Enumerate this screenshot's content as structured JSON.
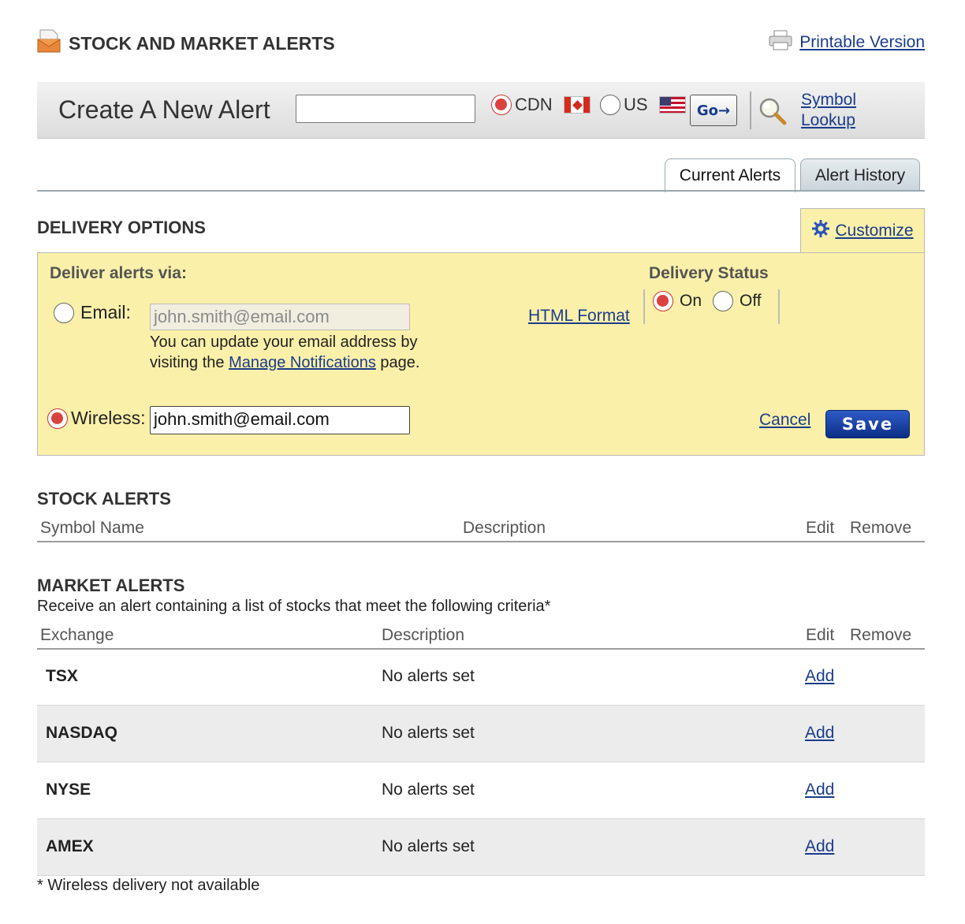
{
  "header": {
    "title": "STOCK AND MARKET ALERTS",
    "printable_label": "Printable Version"
  },
  "create_alert": {
    "title": "Create A New Alert",
    "symbol_value": "",
    "market_options": [
      {
        "label": "CDN",
        "selected": true,
        "flag": "canada-flag-icon"
      },
      {
        "label": "US",
        "selected": false,
        "flag": "us-flag-icon"
      }
    ],
    "go_label": "Go→",
    "symbol_lookup_line1": "Symbol",
    "symbol_lookup_line2": "Lookup"
  },
  "tabs": [
    {
      "label": "Current Alerts",
      "active": true
    },
    {
      "label": "Alert History",
      "active": false
    }
  ],
  "delivery": {
    "section_title": "DELIVERY OPTIONS",
    "customize_label": "Customize",
    "deliver_via_label": "Deliver alerts via:",
    "email_label": "Email:",
    "email_value": "john.smith@email.com",
    "email_selected": false,
    "note_before": "You can update your email address by visiting the ",
    "note_link": "Manage Notifications",
    "note_after": " page.",
    "wireless_label": "Wireless:",
    "wireless_value": "john.smith@email.com",
    "wireless_selected": true,
    "html_format_label": "HTML Format",
    "status_label": "Delivery Status",
    "status_on": "On",
    "status_off": "Off",
    "status_selected": "On",
    "cancel_label": "Cancel",
    "save_label": "Save"
  },
  "stock_alerts": {
    "title": "STOCK ALERTS",
    "columns": [
      "Symbol Name",
      "Description",
      "Edit",
      "Remove"
    ]
  },
  "market_alerts": {
    "title": "MARKET ALERTS",
    "subtitle": "Receive an alert containing a list of stocks that meet the following criteria*",
    "columns": [
      "Exchange",
      "Description",
      "Edit",
      "Remove"
    ],
    "rows": [
      {
        "exchange": "TSX",
        "description": "No alerts set",
        "action": "Add"
      },
      {
        "exchange": "NASDAQ",
        "description": "No alerts set",
        "action": "Add"
      },
      {
        "exchange": "NYSE",
        "description": "No alerts set",
        "action": "Add"
      },
      {
        "exchange": "AMEX",
        "description": "No alerts set",
        "action": "Add"
      }
    ]
  },
  "footnote": "* Wireless delivery not available",
  "colors": {
    "link": "#1a3c8c",
    "delivery_bg": "#fbf0a9",
    "radio_selected": "#d9423f",
    "save_button": "#1a45a8"
  }
}
